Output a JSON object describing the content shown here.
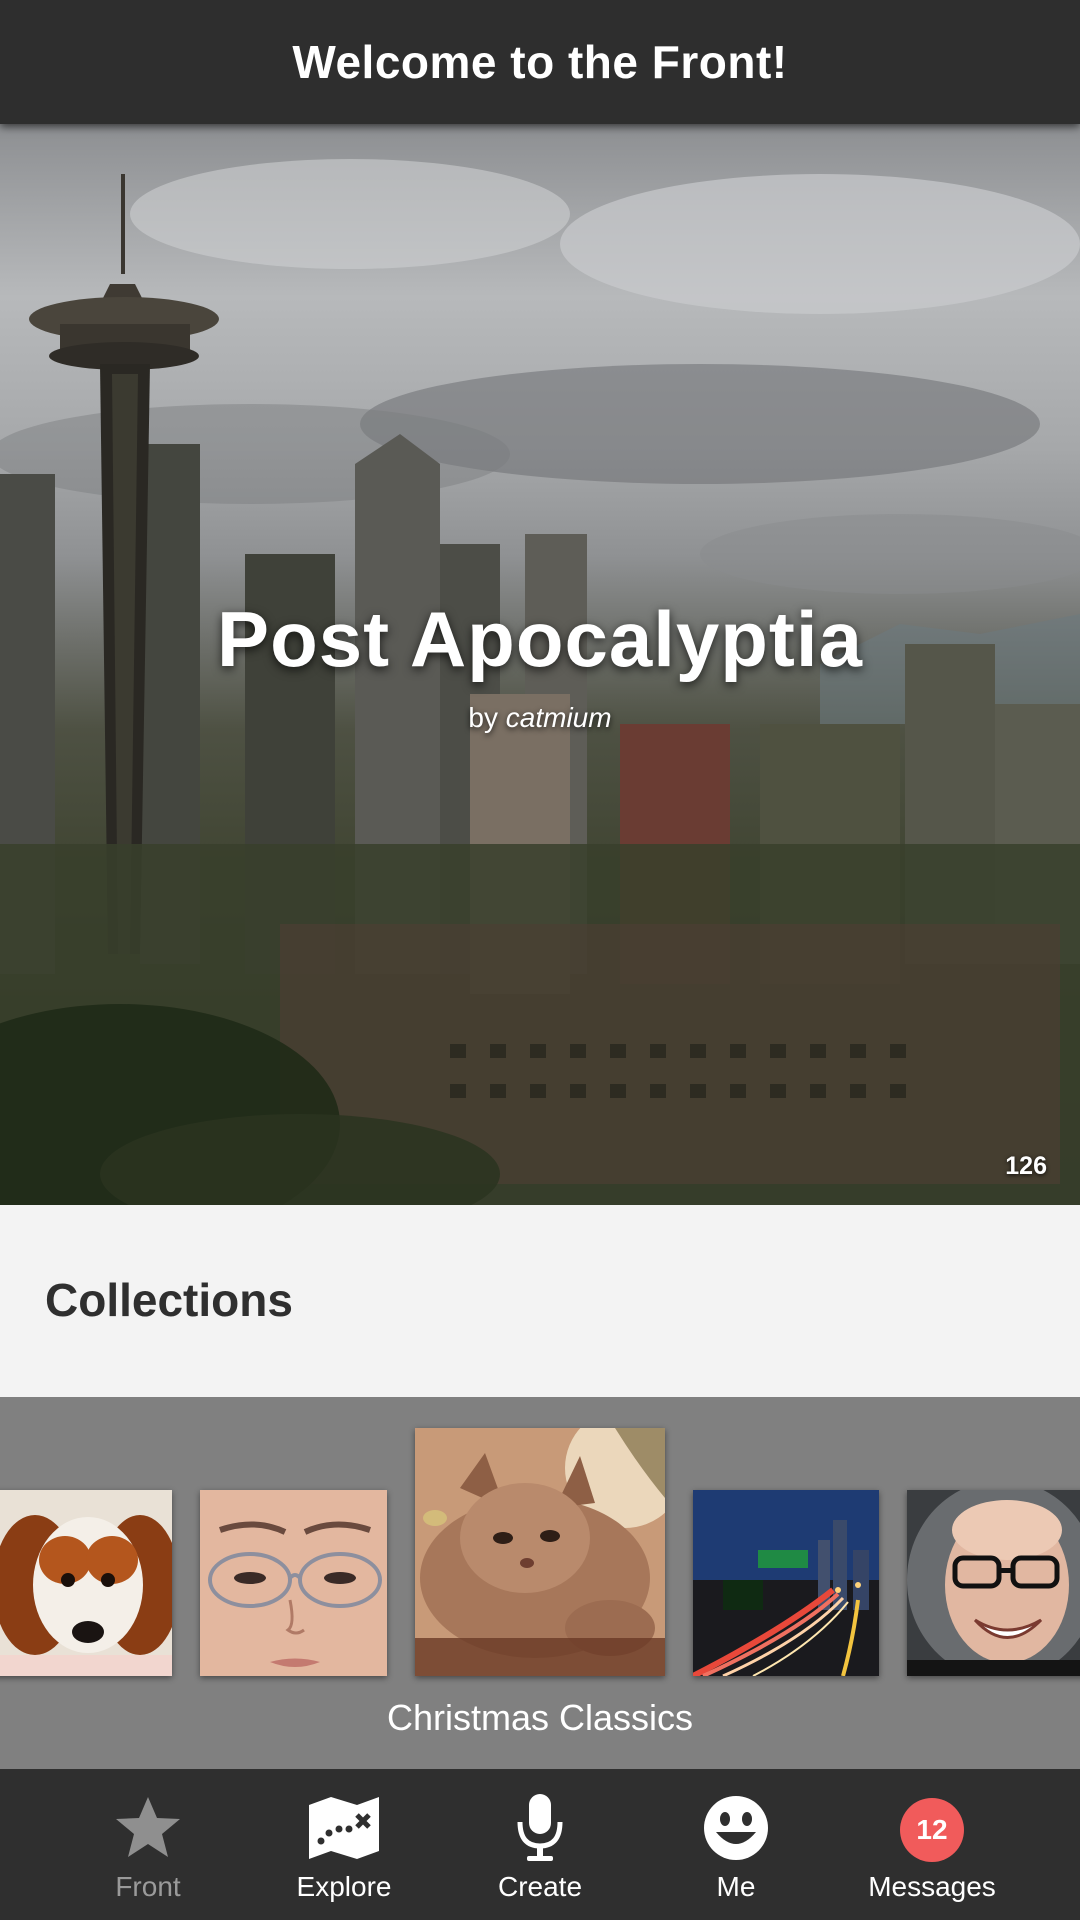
{
  "header": {
    "title": "Welcome to the Front!"
  },
  "featured": {
    "title": "Post Apocalyptia",
    "by_prefix": "by",
    "author": "catmium",
    "count": "126"
  },
  "collections": {
    "heading": "Collections",
    "current_caption": "Christmas Classics",
    "thumbnails": [
      {
        "subject": "puppy"
      },
      {
        "subject": "face-with-glasses"
      },
      {
        "subject": "cat"
      },
      {
        "subject": "city-highway-night"
      },
      {
        "subject": "smiling-man-with-glasses"
      }
    ]
  },
  "nav": {
    "items": [
      {
        "label": "Front",
        "icon": "star-icon",
        "active": true
      },
      {
        "label": "Explore",
        "icon": "map-icon"
      },
      {
        "label": "Create",
        "icon": "microphone-icon"
      },
      {
        "label": "Me",
        "icon": "smiley-icon"
      },
      {
        "label": "Messages",
        "badge": "12"
      }
    ]
  },
  "colors": {
    "header_bg": "#2e2e2e",
    "badge": "#f15b5b",
    "carousel_bg": "#808080"
  }
}
